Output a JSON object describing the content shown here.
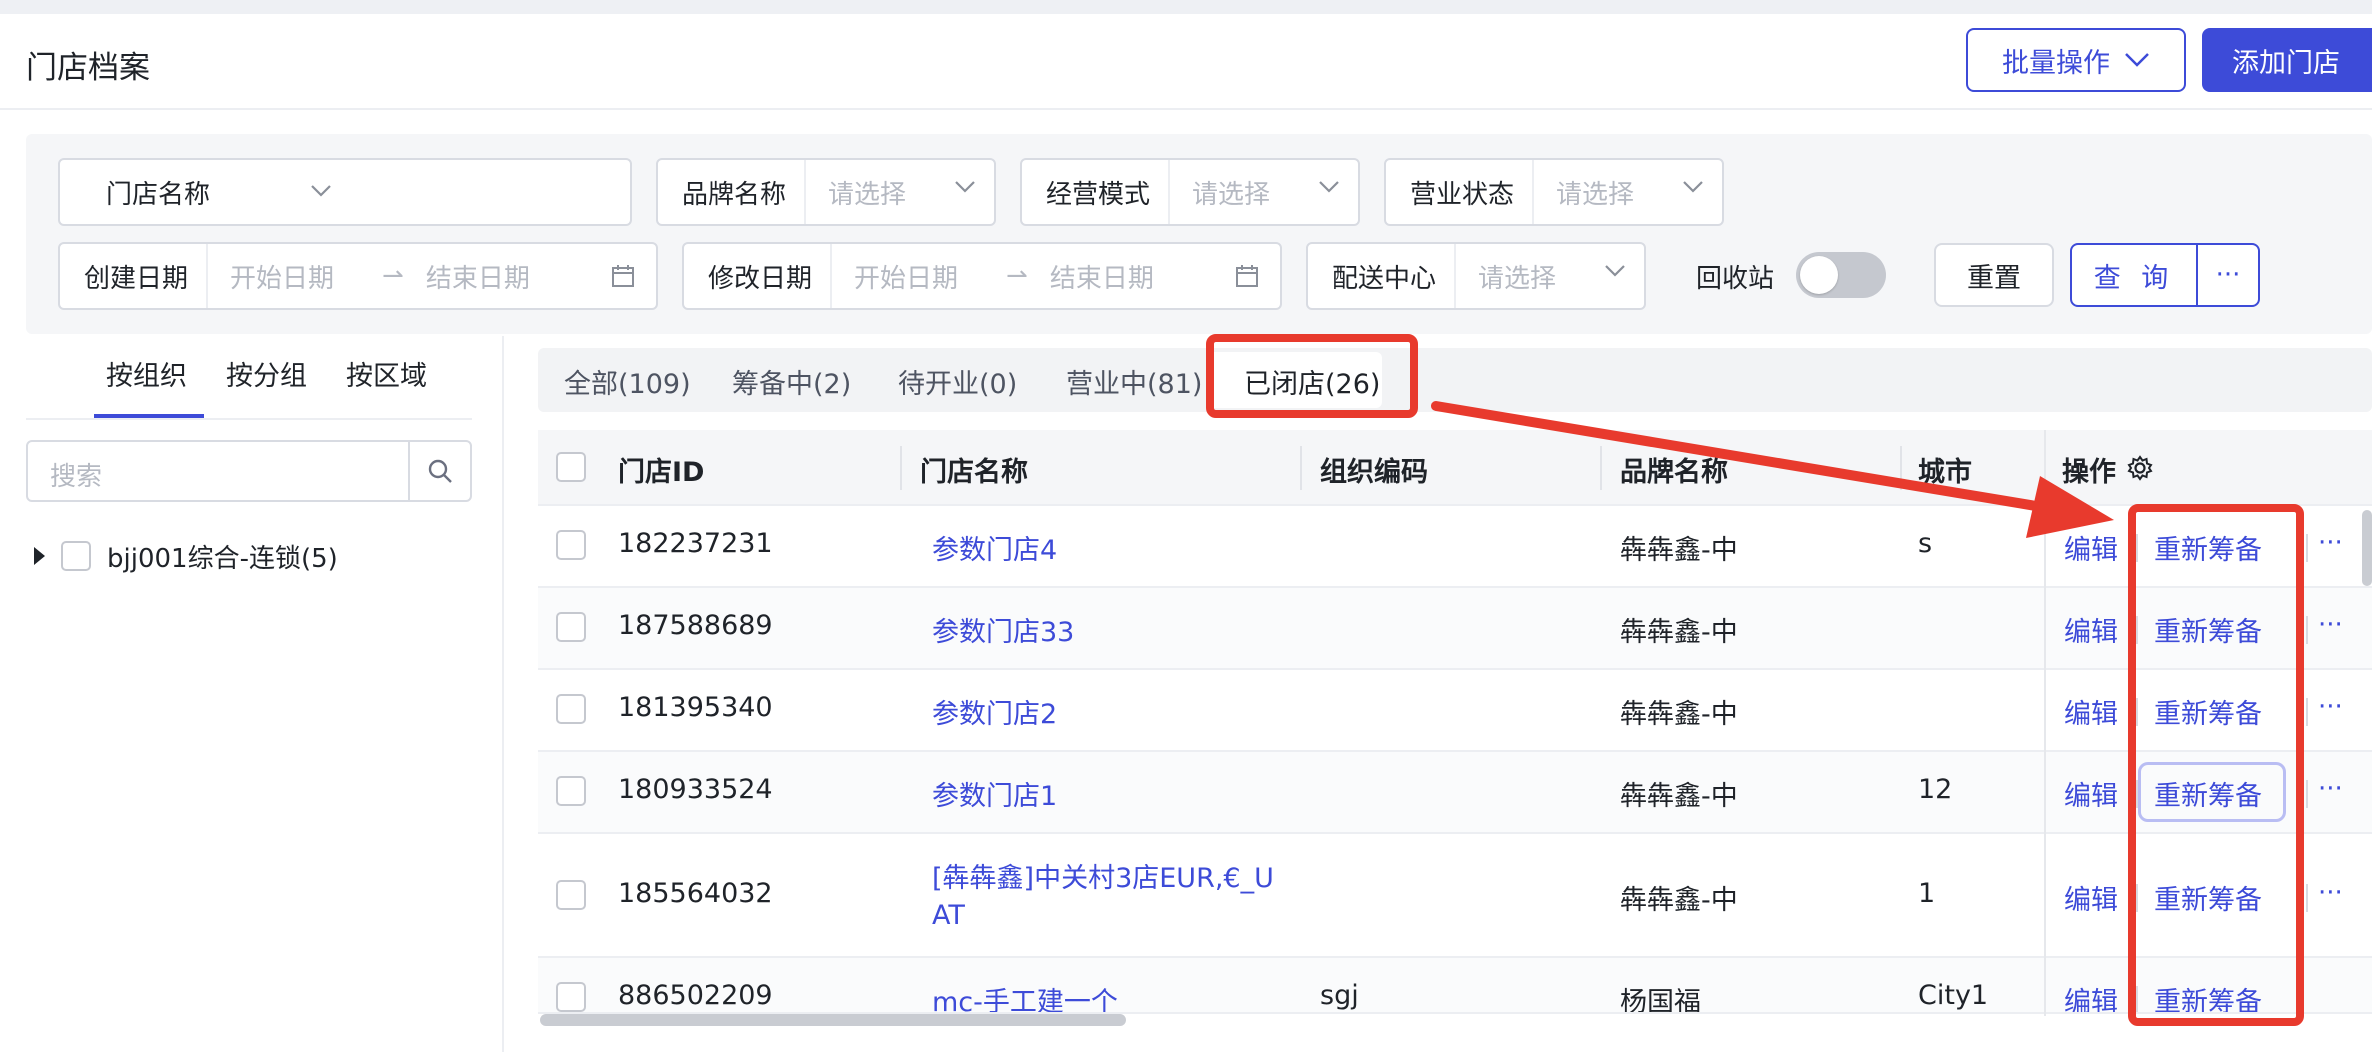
{
  "header": {
    "title": "门店档案",
    "batch_label": "批量操作",
    "add_label": "添加门店"
  },
  "filters": {
    "store_name_select": "门店名称",
    "brand": {
      "label": "品牌名称",
      "placeholder": "请选择"
    },
    "mode": {
      "label": "经营模式",
      "placeholder": "请选择"
    },
    "status": {
      "label": "营业状态",
      "placeholder": "请选择"
    },
    "created": {
      "label": "创建日期",
      "start": "开始日期",
      "end": "结束日期"
    },
    "modified": {
      "label": "修改日期",
      "start": "开始日期",
      "end": "结束日期"
    },
    "dc": {
      "label": "配送中心",
      "placeholder": "请选择"
    },
    "recycle_label": "回收站",
    "recycle_on": false,
    "reset_label": "重置",
    "query_label": "查 询",
    "more_label": "···"
  },
  "tree": {
    "tabs": [
      "按组织",
      "按分组",
      "按区域"
    ],
    "active_tab": 0,
    "search_placeholder": "搜索",
    "node_label": "bjj001综合-连锁(5)"
  },
  "status_tabs": [
    "全部(109)",
    "筹备中(2)",
    "待开业(0)",
    "营业中(81)",
    "已闭店(26)"
  ],
  "active_status_tab": 4,
  "table": {
    "columns": [
      "门店ID",
      "门店名称",
      "组织编码",
      "品牌名称",
      "城市",
      "操作"
    ],
    "rows": [
      {
        "id": "182237231",
        "name": "参数门店4",
        "name2": "",
        "org": "",
        "brand": "犇犇鑫-中",
        "city": "s"
      },
      {
        "id": "187588689",
        "name": "参数门店33",
        "name2": "",
        "org": "",
        "brand": "犇犇鑫-中",
        "city": ""
      },
      {
        "id": "181395340",
        "name": "参数门店2",
        "name2": "",
        "org": "",
        "brand": "犇犇鑫-中",
        "city": ""
      },
      {
        "id": "180933524",
        "name": "参数门店1",
        "name2": "",
        "org": "",
        "brand": "犇犇鑫-中",
        "city": "12"
      },
      {
        "id": "185564032",
        "name": "[犇犇鑫]中关村3店EUR,€_U",
        "name2": "AT",
        "org": "",
        "brand": "犇犇鑫-中",
        "city": "1"
      },
      {
        "id": "886502209",
        "name": "mc-手工建一个",
        "name2": "",
        "org": "sgj",
        "brand": "杨国福",
        "city": "City1"
      }
    ],
    "op_edit": "编辑",
    "op_reprepare": "重新筹备",
    "op_more": "···"
  },
  "colors": {
    "primary": "#3d4bd8",
    "annotation": "#e83a2d"
  }
}
